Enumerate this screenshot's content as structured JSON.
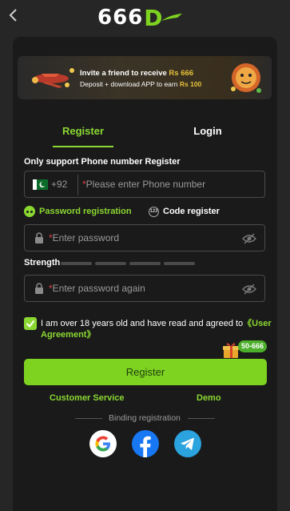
{
  "header": {
    "logo_text": "666",
    "logo_d": "D"
  },
  "banner": {
    "line1_prefix": "Invite a friend to receive",
    "line1_amount": "Rs 666",
    "line2_prefix": "Deposit + download APP to earn",
    "line2_amount": "Rs 100"
  },
  "tabs": {
    "register": "Register",
    "login": "Login"
  },
  "form": {
    "phone_note": "Only support Phone number Register",
    "country_code": "+92",
    "phone_placeholder": "Please enter Phone number",
    "mode_password": "Password registration",
    "mode_code": "Code register",
    "code_icon_text": "123",
    "password_placeholder": "Enter password",
    "strength_label": "Strength",
    "password_again_placeholder": "Enter password again",
    "required_mark": "*",
    "agree_text": "I am over 18 years old and have read and agreed to",
    "agree_link": "《User Agreement》",
    "bonus_badge": "50-666",
    "register_button": "Register",
    "customer_service": "Customer Service",
    "demo": "Demo",
    "binding_label": "Binding registration"
  },
  "colors": {
    "accent": "#8bd832",
    "button": "#7ed321",
    "panel": "#1a1a1a",
    "background": "#262626"
  },
  "icons": [
    "back-chevron-icon",
    "pakistan-flag-icon",
    "dots-icon",
    "lock-icon",
    "eye-off-icon",
    "checkbox-icon",
    "gift-icon",
    "google-icon",
    "facebook-icon",
    "telegram-icon"
  ]
}
